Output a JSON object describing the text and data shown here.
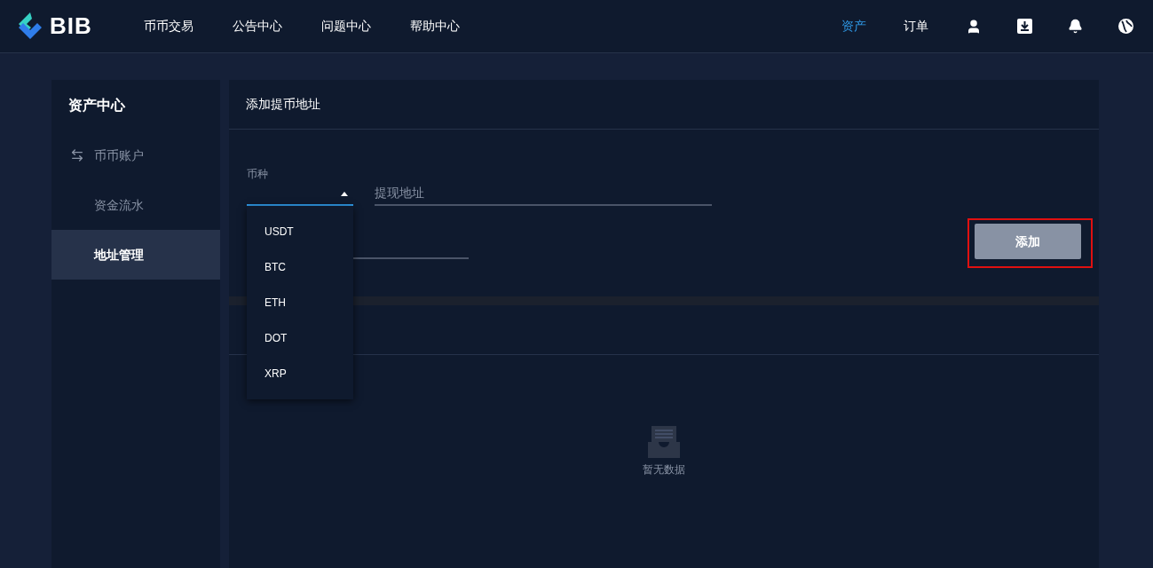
{
  "header": {
    "logo_text": "BIB",
    "nav": [
      {
        "label": "币币交易"
      },
      {
        "label": "公告中心"
      },
      {
        "label": "问题中心"
      },
      {
        "label": "帮助中心"
      }
    ],
    "right_nav": [
      {
        "label": "资产",
        "selected": true
      },
      {
        "label": "订单",
        "selected": false
      }
    ]
  },
  "sidebar": {
    "title": "资产中心",
    "items": [
      {
        "label": "币币账户",
        "selected": false,
        "children": [
          {
            "label": "资金流水",
            "selected": false
          },
          {
            "label": "地址管理",
            "selected": true
          }
        ]
      }
    ]
  },
  "panel": {
    "title": "添加提币地址",
    "currency_field": {
      "label": "币种",
      "focused": true,
      "options": [
        "USDT",
        "BTC",
        "ETH",
        "DOT",
        "XRP"
      ]
    },
    "address_field": {
      "placeholder": "提现地址"
    },
    "add_button": {
      "label": "添加",
      "highlighted": true
    },
    "empty_state": {
      "text": "暂无数据"
    }
  }
}
